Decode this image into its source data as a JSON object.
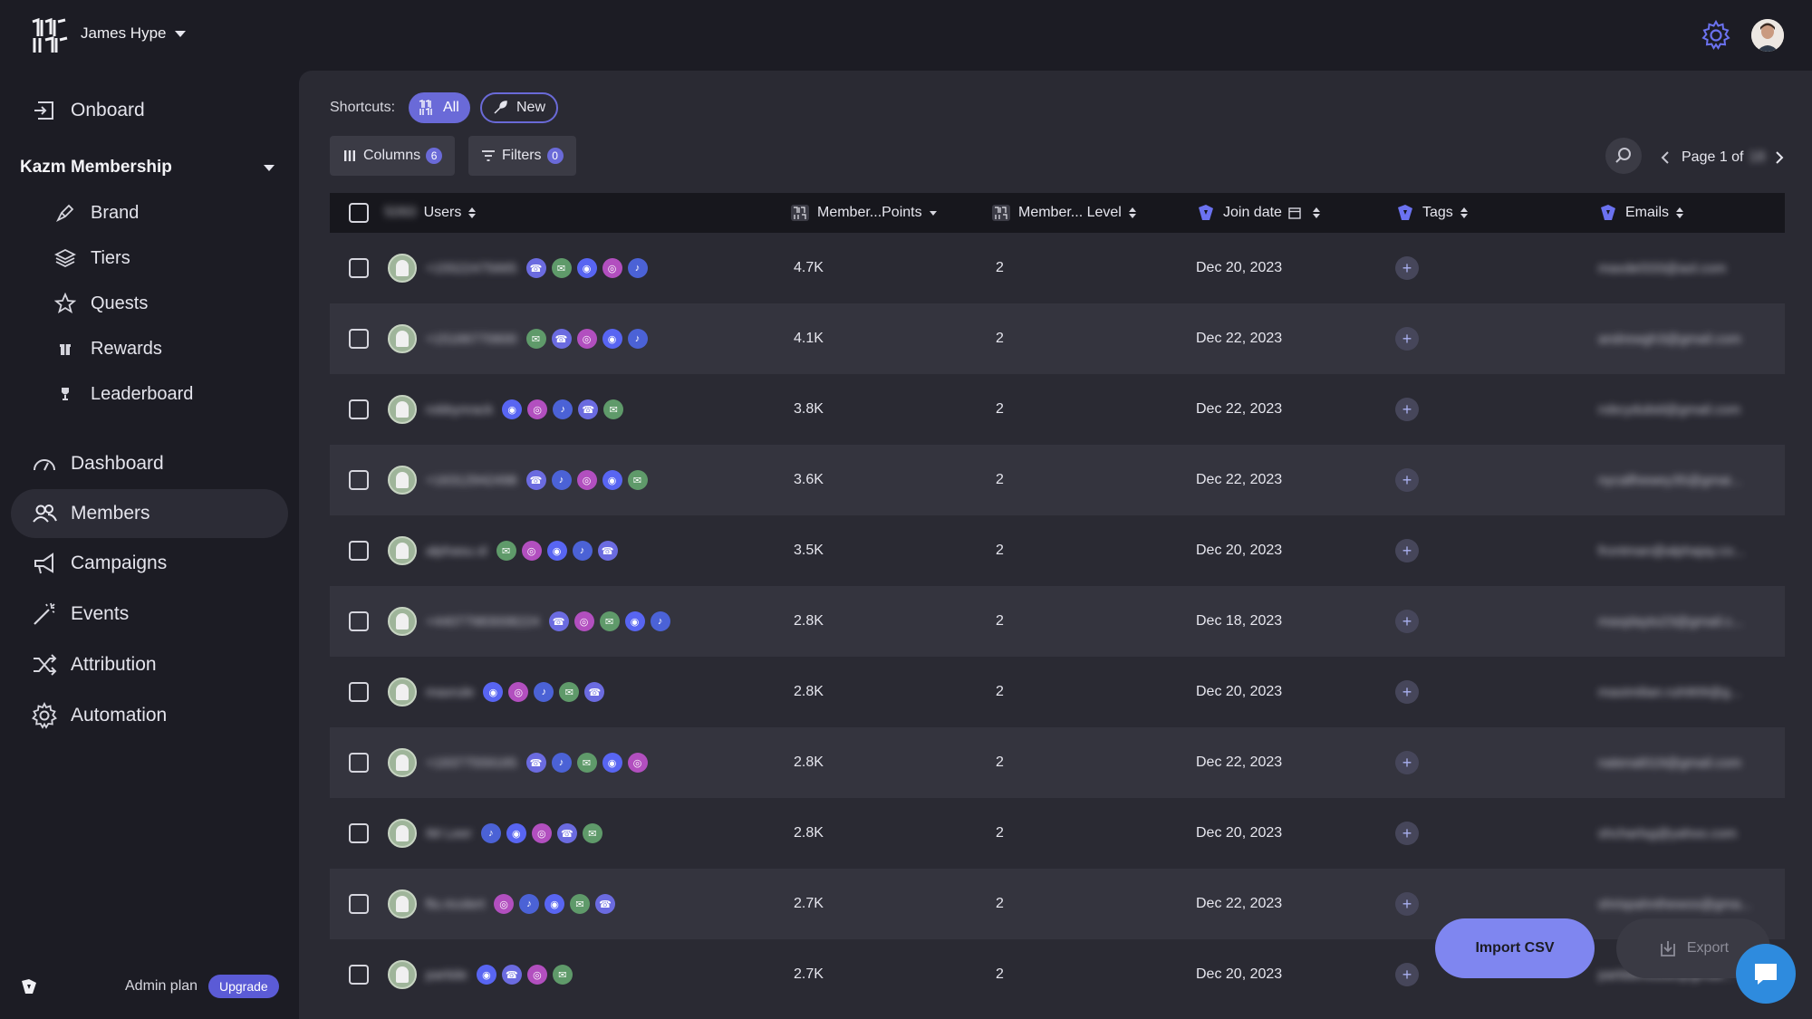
{
  "workspace": {
    "name": "James Hype"
  },
  "sidebar": {
    "onboard": "Onboard",
    "section_title": "Kazm Membership",
    "sub_items": [
      {
        "label": "Brand",
        "icon": "brand-icon"
      },
      {
        "label": "Tiers",
        "icon": "tiers-icon"
      },
      {
        "label": "Quests",
        "icon": "star-icon"
      },
      {
        "label": "Rewards",
        "icon": "gift-icon"
      },
      {
        "label": "Leaderboard",
        "icon": "trophy-icon"
      }
    ],
    "items": [
      {
        "label": "Dashboard",
        "icon": "gauge-icon"
      },
      {
        "label": "Members",
        "icon": "users-icon",
        "active": true
      },
      {
        "label": "Campaigns",
        "icon": "megaphone-icon"
      },
      {
        "label": "Events",
        "icon": "magic-wand-icon"
      },
      {
        "label": "Attribution",
        "icon": "shuffle-icon"
      },
      {
        "label": "Automation",
        "icon": "gear-icon"
      }
    ],
    "plan_label": "Admin plan",
    "upgrade_label": "Upgrade"
  },
  "toolbar": {
    "shortcuts_label": "Shortcuts:",
    "chip_all": "All",
    "chip_new": "New",
    "columns_label": "Columns",
    "columns_count": "6",
    "filters_label": "Filters",
    "filters_count": "0",
    "page_label": "Page 1 of",
    "page_total": "18"
  },
  "table": {
    "user_count": "5060",
    "headers": {
      "users": "Users",
      "points": "Member...Points",
      "level": "Member... Level",
      "join_date": "Join date",
      "tags": "Tags",
      "emails": "Emails"
    },
    "rows": [
      {
        "user": "+15522475665",
        "socials": [
          "phone",
          "email",
          "discord",
          "instagram",
          "tiktok"
        ],
        "points": "4.7K",
        "level": "2",
        "join_date": "Dec 20, 2023",
        "email": "maxdel333@aol.com"
      },
      {
        "user": "+15166770600",
        "socials": [
          "email",
          "phone",
          "instagram",
          "discord",
          "tiktok"
        ],
        "points": "4.1K",
        "level": "2",
        "join_date": "Dec 22, 2023",
        "email": "andrewgh3@gmail.com"
      },
      {
        "user": "robbynrack",
        "socials": [
          "discord",
          "instagram",
          "tiktok",
          "phone",
          "email"
        ],
        "points": "3.8K",
        "level": "2",
        "join_date": "Dec 22, 2023",
        "email": "robcydubid@gmail.com"
      },
      {
        "user": "+16312942498",
        "socials": [
          "phone",
          "tiktok",
          "instagram",
          "discord",
          "email"
        ],
        "points": "3.6K",
        "level": "2",
        "join_date": "Dec 22, 2023",
        "email": "nycallhewey35@gmai..."
      },
      {
        "user": "alphasu.sl",
        "socials": [
          "email",
          "instagram",
          "discord",
          "tiktok",
          "phone"
        ],
        "points": "3.5K",
        "level": "2",
        "join_date": "Dec 20, 2023",
        "email": "frontman@alphajay.co..."
      },
      {
        "user": "+44077983008224",
        "socials": [
          "phone",
          "instagram",
          "email",
          "discord",
          "tiktok"
        ],
        "points": "2.8K",
        "level": "2",
        "join_date": "Dec 18, 2023",
        "email": "maxplayto23@gmail.c..."
      },
      {
        "user": "maxrule",
        "socials": [
          "discord",
          "instagram",
          "tiktok",
          "email",
          "phone"
        ],
        "points": "2.8K",
        "level": "2",
        "join_date": "Dec 20, 2023",
        "email": "maximilian.ruh909@g..."
      },
      {
        "user": "+19377559165",
        "socials": [
          "phone",
          "tiktok",
          "email",
          "discord",
          "instagram"
        ],
        "points": "2.8K",
        "level": "2",
        "join_date": "Dec 22, 2023",
        "email": "natenal019@gmail.com"
      },
      {
        "user": "IM Leer",
        "socials": [
          "tiktok",
          "discord",
          "instagram",
          "phone",
          "email"
        ],
        "points": "2.8K",
        "level": "2",
        "join_date": "Dec 20, 2023",
        "email": "shcharlsg@yahoo.com"
      },
      {
        "user": "fts.ricolert",
        "socials": [
          "instagram",
          "tiktok",
          "discord",
          "email",
          "phone"
        ],
        "points": "2.7K",
        "level": "2",
        "join_date": "Dec 22, 2023",
        "email": "shrispahnthewos@gma..."
      },
      {
        "user": "partide",
        "socials": [
          "discord",
          "phone",
          "instagram",
          "email"
        ],
        "points": "2.7K",
        "level": "2",
        "join_date": "Dec 20, 2023",
        "email": "partidehouse@gmail..."
      }
    ]
  },
  "actions": {
    "import_label": "Import CSV",
    "export_label": "Export"
  }
}
